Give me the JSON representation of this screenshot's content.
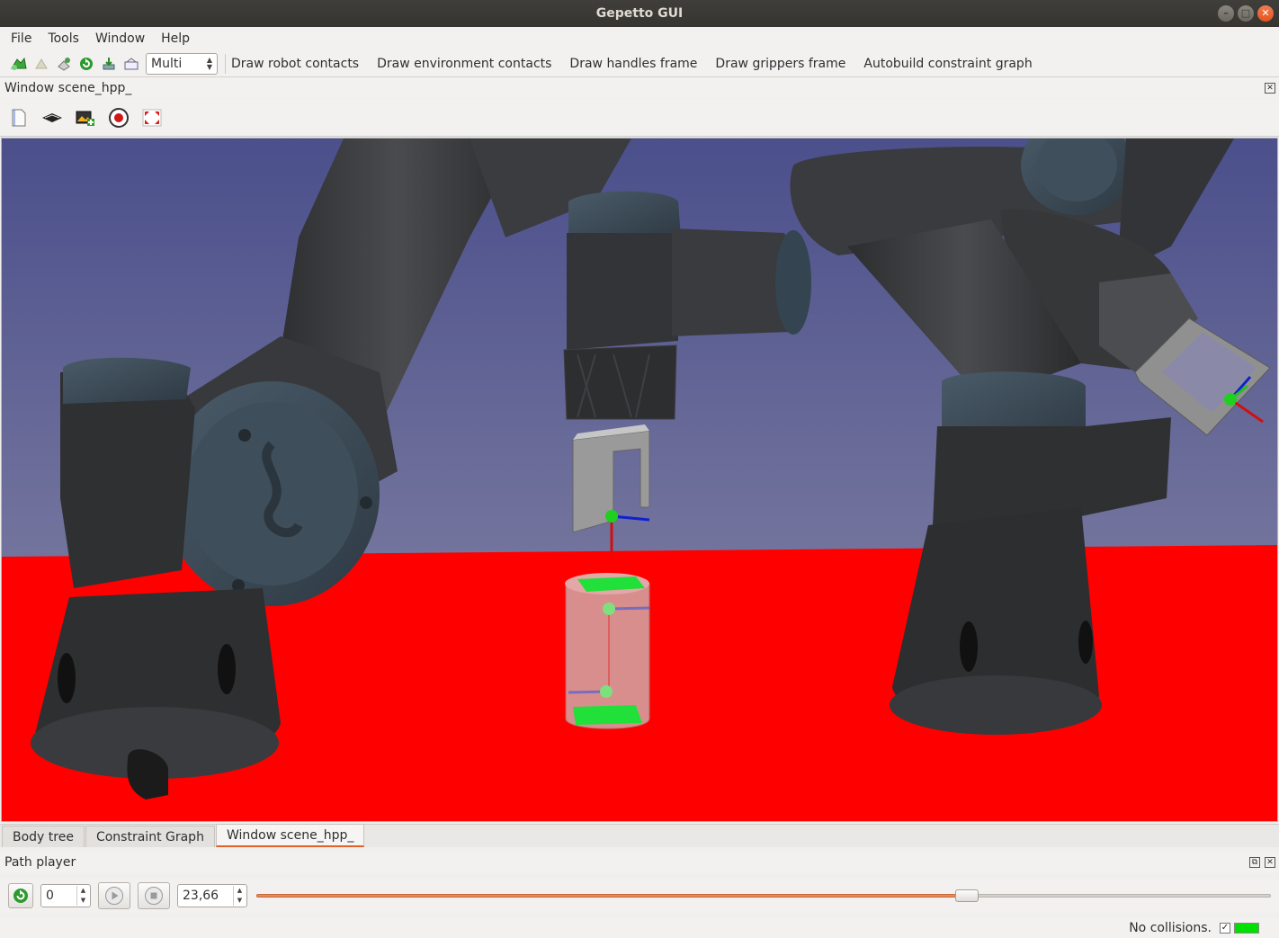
{
  "window": {
    "title": "Gepetto GUI",
    "controls": [
      "minimize",
      "maximize",
      "close"
    ]
  },
  "menu": [
    "File",
    "Tools",
    "Window",
    "Help"
  ],
  "toolbar": {
    "icons": [
      "add-robot-icon",
      "disabled-action-icon",
      "add-object-icon",
      "refresh-icon",
      "load-icon",
      "environment-icon"
    ],
    "mode_combo": "Multi",
    "actions": [
      "Draw robot contacts",
      "Draw environment contacts",
      "Draw handles frame",
      "Draw grippers frame",
      "Autobuild constraint graph"
    ]
  },
  "scene_dock": {
    "title": "Window scene_hpp_",
    "tools": [
      "document-icon",
      "ground-plane-icon",
      "add-image-icon",
      "record-icon",
      "fullscreen-icon"
    ]
  },
  "tabs": {
    "items": [
      "Body tree",
      "Constraint Graph",
      "Window scene_hpp_"
    ],
    "active": "Window scene_hpp_"
  },
  "path_player": {
    "title": "Path player",
    "path_index": "0",
    "time_value": "23,66",
    "progress": 0.7
  },
  "status": {
    "text": "No collisions.",
    "checkbox_checked": true,
    "indicator_color": "#00e000"
  },
  "colors": {
    "accent": "#e2612a",
    "floor": "#ff0000",
    "sky_top": "#4a4f8a",
    "sky_bottom": "#8a8aa8",
    "robot_dark": "#3a3b3d",
    "robot_cap": "#3d4c59",
    "object_highlight": "#25e23a"
  }
}
